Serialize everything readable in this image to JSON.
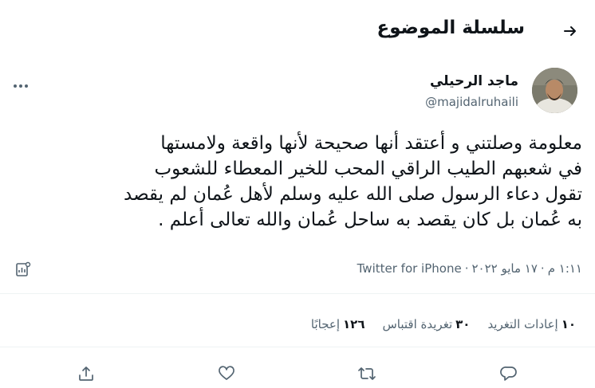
{
  "header": {
    "title": "سلسلة الموضوع",
    "back_icon": "arrow-right-icon"
  },
  "author": {
    "name": "ماجد الرحيلي",
    "handle": "@majidalruhaili"
  },
  "tweet": {
    "lines": [
      "معلومة وصلتني و أعتقد أنها صحيحة لأنها واقعة ولامستها",
      "في شعبهم الطيب الراقي المحب للخير المعطاء للشعوب",
      "تقول دعاء الرسول صلى الله عليه وسلم لأهل عُمان لم يقصد",
      "به عُمان بل كان يقصد به ساحل عُمان والله تعالى أعلم ."
    ]
  },
  "meta": {
    "time": "١:١١ م",
    "separator1": "·",
    "date": "١٧ مايو ٢٠٢٢",
    "separator2": "·",
    "source": "Twitter for iPhone"
  },
  "stats": {
    "retweets_count": "١٠",
    "retweets_label": "إعادات التغريد",
    "quotes_count": "٣٠",
    "quotes_label": "تغريدة اقتباس",
    "likes_count": "١٢٦",
    "likes_label": "إعجابًا"
  },
  "colors": {
    "text": "#0f1419",
    "secondary": "#536471",
    "divider": "#eff3f4"
  }
}
